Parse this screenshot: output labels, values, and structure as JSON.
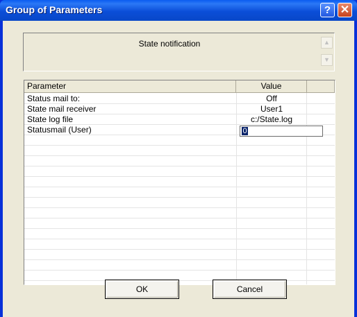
{
  "window": {
    "title": "Group of Parameters"
  },
  "titlebar": {
    "help_icon": "question-mark-icon",
    "close_icon": "close-x-icon",
    "help_glyph": "?",
    "close_glyph": "✕"
  },
  "info": {
    "text": "State notification"
  },
  "table": {
    "headers": [
      "Parameter",
      "Value"
    ],
    "rows": [
      {
        "param": "Status mail to:",
        "value": "Off"
      },
      {
        "param": "State mail receiver",
        "value": "User1"
      },
      {
        "param": "State log file",
        "value": "c:/State.log"
      },
      {
        "param": "Statusmail (User)",
        "value": "0",
        "editing": true
      }
    ]
  },
  "buttons": {
    "ok": "OK",
    "cancel": "Cancel"
  },
  "colors": {
    "titlebar": "#0b4ed8",
    "dialog": "#ece9d8",
    "selection": "#0a246a"
  }
}
